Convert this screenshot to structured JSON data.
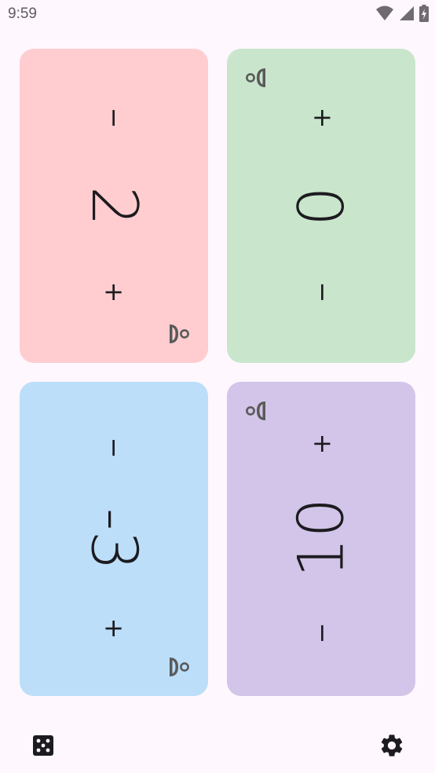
{
  "status_bar": {
    "time": "9:59",
    "icons": [
      "wifi-icon",
      "signal-icon",
      "battery-charging-icon"
    ]
  },
  "players": [
    {
      "id": "player-1",
      "life": "2",
      "color": "#ffcdd0",
      "top_button": "−",
      "bottom_button": "+",
      "orientation": "cw"
    },
    {
      "id": "player-2",
      "life": "0",
      "color": "#c9e6cc",
      "top_button": "+",
      "bottom_button": "−",
      "orientation": "ccw"
    },
    {
      "id": "player-3",
      "life": "-3",
      "color": "#bcdef9",
      "top_button": "−",
      "bottom_button": "+",
      "orientation": "cw"
    },
    {
      "id": "player-4",
      "life": "10",
      "color": "#d2c5e9",
      "top_button": "+",
      "bottom_button": "−",
      "orientation": "ccw"
    }
  ],
  "bottom_bar": {
    "left_icon": "dice-icon",
    "right_icon": "gear-icon"
  }
}
